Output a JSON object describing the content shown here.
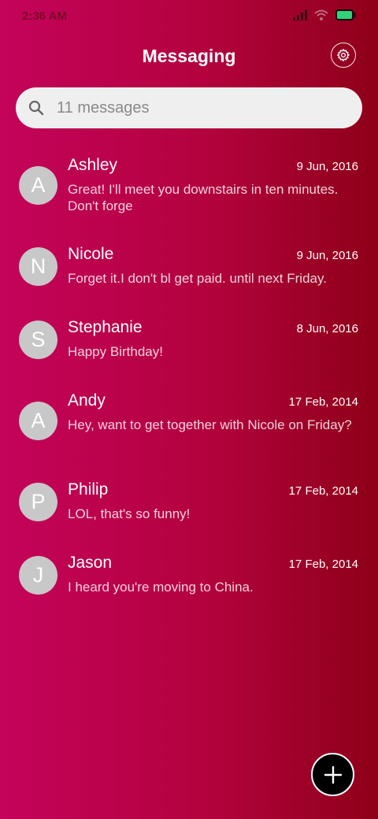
{
  "status_bar": {
    "time": "2:36 AM",
    "icons": [
      "signal-icon",
      "wifi-icon",
      "battery-icon"
    ],
    "battery_color": "#33d17a"
  },
  "header": {
    "title": "Messaging",
    "settings_icon": "gear-icon"
  },
  "search": {
    "icon": "search-icon",
    "text": "11 messages"
  },
  "messages": [
    {
      "initial": "A",
      "name": "Ashley",
      "date": "9 Jun, 2016",
      "preview": "Great! I'll meet you downstairs in ten minutes. Don't forge"
    },
    {
      "initial": "N",
      "name": "Nicole",
      "date": "9 Jun, 2016",
      "preview": "Forget it.I don't bl get paid. until next Friday."
    },
    {
      "initial": "S",
      "name": "Stephanie",
      "date": "8 Jun, 2016",
      "preview": "Happy Birthday!"
    },
    {
      "initial": "A",
      "name": "Andy",
      "date": "17 Feb, 2014",
      "preview": "Hey, want to get together with Nicole on Friday?"
    },
    {
      "initial": "P",
      "name": "Philip",
      "date": "17 Feb, 2014",
      "preview": "LOL, that's so funny!"
    },
    {
      "initial": "J",
      "name": "Jason",
      "date": "17 Feb, 2014",
      "preview": "I heard you're moving to China."
    }
  ],
  "fab": {
    "icon": "plus-icon"
  },
  "colors": {
    "gradient_start": "#c4035a",
    "gradient_end": "#8e0018",
    "avatar_bg": "#c8c8c8"
  }
}
